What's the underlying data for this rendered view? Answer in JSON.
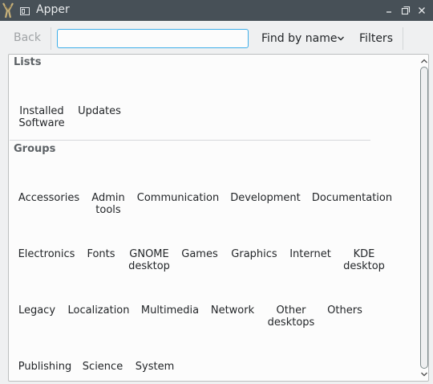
{
  "window": {
    "title": "Apper",
    "titlebar_color": "#475057",
    "icons": [
      "app-icon",
      "pin-icon",
      "minimize-icon",
      "maximize-icon",
      "close-icon"
    ]
  },
  "toolbar": {
    "back_label": "Back",
    "search_value": "",
    "search_placeholder": "",
    "find_mode_label": "Find by name",
    "filters_label": "Filters",
    "accent_color": "#3daee9"
  },
  "lists": {
    "header": "Lists",
    "items": [
      {
        "label": "Installed\nSoftware"
      },
      {
        "label": "Updates"
      }
    ]
  },
  "groups": {
    "header": "Groups",
    "items": [
      {
        "label": "Accessories"
      },
      {
        "label": "Admin\ntools"
      },
      {
        "label": "Communication"
      },
      {
        "label": "Development"
      },
      {
        "label": "Documentation"
      },
      {
        "label": "Electronics"
      },
      {
        "label": "Fonts"
      },
      {
        "label": "GNOME\ndesktop"
      },
      {
        "label": "Games"
      },
      {
        "label": "Graphics"
      },
      {
        "label": "Internet"
      },
      {
        "label": "KDE\ndesktop"
      },
      {
        "label": "Legacy"
      },
      {
        "label": "Localization"
      },
      {
        "label": "Multimedia"
      },
      {
        "label": "Network"
      },
      {
        "label": "Other\ndesktops"
      },
      {
        "label": "Others"
      },
      {
        "label": "Publishing"
      },
      {
        "label": "Science"
      },
      {
        "label": "System"
      }
    ]
  }
}
